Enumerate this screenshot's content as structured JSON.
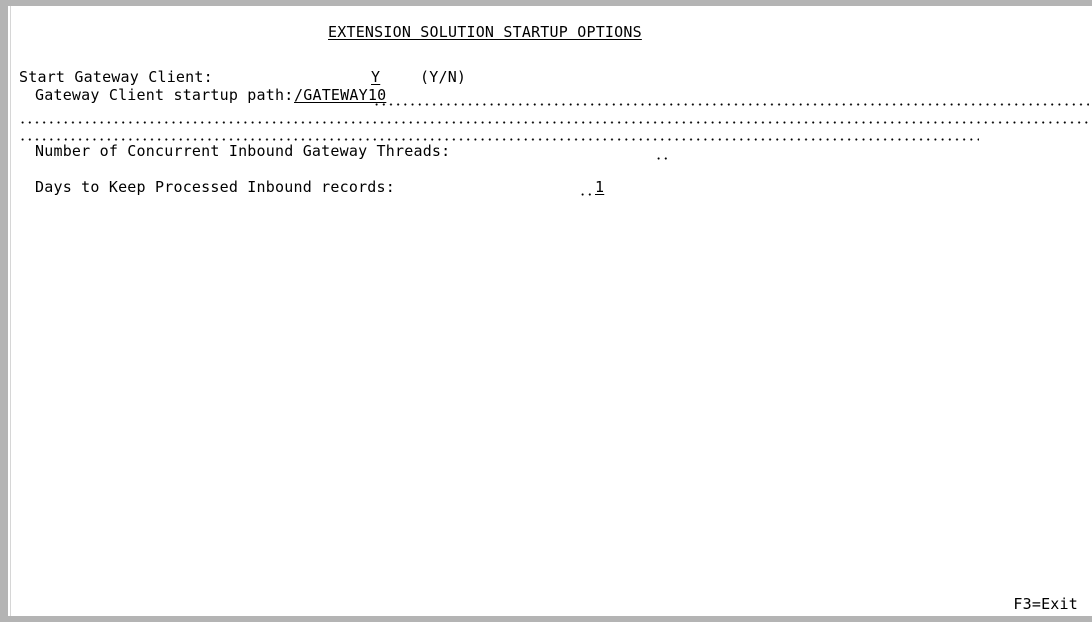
{
  "screen": {
    "title": "EXTENSION SOLUTION STARTUP OPTIONS"
  },
  "gateway_client": {
    "label": "Start Gateway Client:",
    "value": "Y",
    "hint": "(Y/N)"
  },
  "startup_path": {
    "label": "Gateway Client startup path:",
    "value": "/GATEWAY10"
  },
  "threads": {
    "label": "Number of Concurrent Inbound Gateway Threads:",
    "value": ""
  },
  "days_keep": {
    "label": "Days to Keep Processed Inbound records:",
    "value": "1"
  },
  "function_keys": {
    "exit": "F3=Exit"
  }
}
